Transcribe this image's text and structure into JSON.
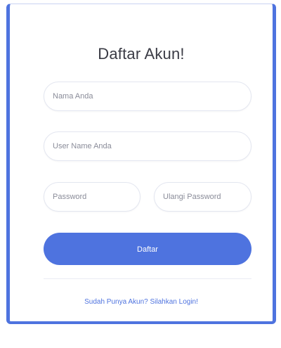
{
  "form": {
    "title": "Daftar Akun!",
    "nama_placeholder": "Nama Anda",
    "username_placeholder": "User Name Anda",
    "password_placeholder": "Password",
    "ulangi_password_placeholder": "Ulangi Password",
    "submit_label": "Daftar",
    "login_link": "Sudah Punya Akun? Silahkan Login!"
  },
  "colors": {
    "accent": "#4e73df",
    "title_text": "#3a3b45",
    "field_border": "#e3e6f0"
  }
}
